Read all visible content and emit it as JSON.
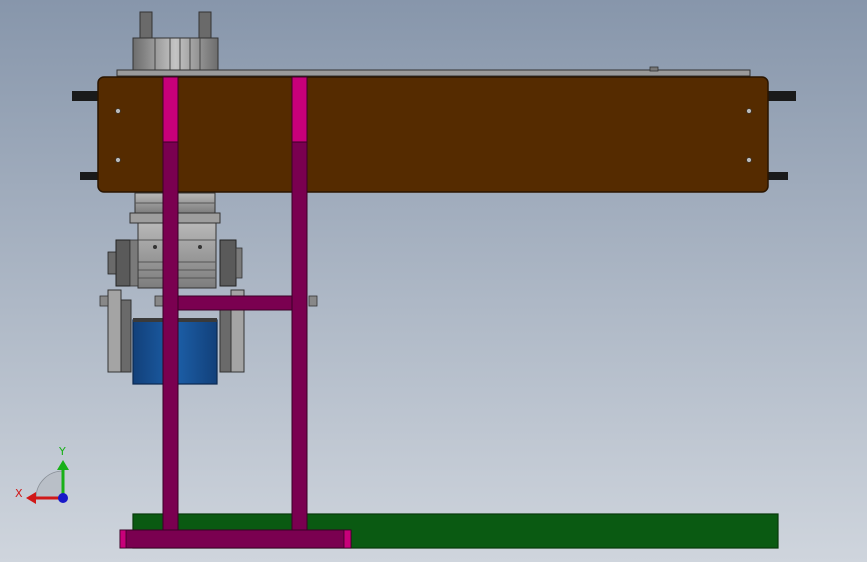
{
  "viewport": {
    "background_top": "#8796ab",
    "background_bottom": "#cfd5dd"
  },
  "model": {
    "conveyor_color": "#552b00",
    "frame_color": "#7a0050",
    "frame_highlight_color": "#c8007a",
    "base_color": "#0a5a12",
    "motor_color": "#1c5fa8",
    "cylinder_color": "#a8a8a8"
  },
  "triad": {
    "x_label": "X",
    "y_label": "Y",
    "x_color": "#d01818",
    "y_color": "#18b018",
    "z_color": "#1818c8"
  }
}
